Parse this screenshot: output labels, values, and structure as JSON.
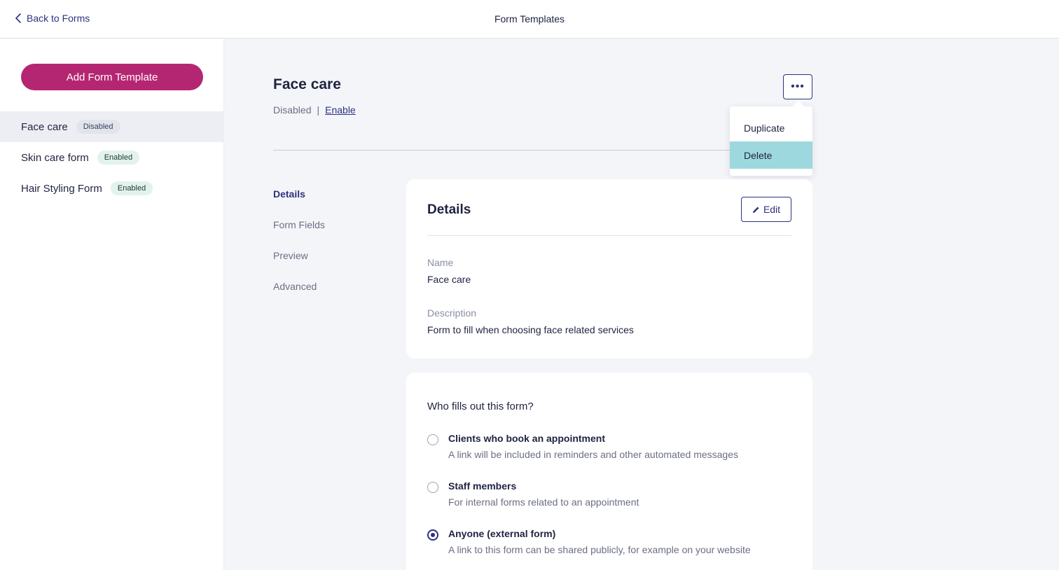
{
  "header": {
    "back_label": "Back to Forms",
    "title": "Form Templates"
  },
  "sidebar": {
    "add_button_label": "Add Form Template",
    "items": [
      {
        "name": "Face care",
        "status": "Disabled",
        "active": true
      },
      {
        "name": "Skin care form",
        "status": "Enabled",
        "active": false
      },
      {
        "name": "Hair Styling Form",
        "status": "Enabled",
        "active": false
      }
    ]
  },
  "template": {
    "name": "Face care",
    "status": "Disabled",
    "separator": "|",
    "enable_link": "Enable",
    "more_button_icon": "ellipsis-icon"
  },
  "menu": {
    "items": [
      "Duplicate",
      "Delete"
    ],
    "highlighted": "Delete"
  },
  "section_nav": {
    "items": [
      "Details",
      "Form Fields",
      "Preview",
      "Advanced"
    ],
    "active": "Details"
  },
  "details_card": {
    "title": "Details",
    "edit_label": "Edit",
    "name_label": "Name",
    "name_value": "Face care",
    "description_label": "Description",
    "description_value": "Form to fill when choosing face related services"
  },
  "who_card": {
    "title": "Who fills out this form?",
    "options": [
      {
        "label": "Clients who book an appointment",
        "description": "A link will be included in reminders and other automated messages",
        "selected": false
      },
      {
        "label": "Staff members",
        "description": "For internal forms related to an appointment",
        "selected": false
      },
      {
        "label": "Anyone (external form)",
        "description": "A link to this form can be shared publicly, for example on your website",
        "selected": true
      }
    ]
  },
  "colors": {
    "accent": "#b52672",
    "primary": "#2c3280",
    "menu_highlight": "#9dd8de",
    "enabled_badge": "#e2f2ec",
    "disabled_badge": "#e2e4ec"
  }
}
